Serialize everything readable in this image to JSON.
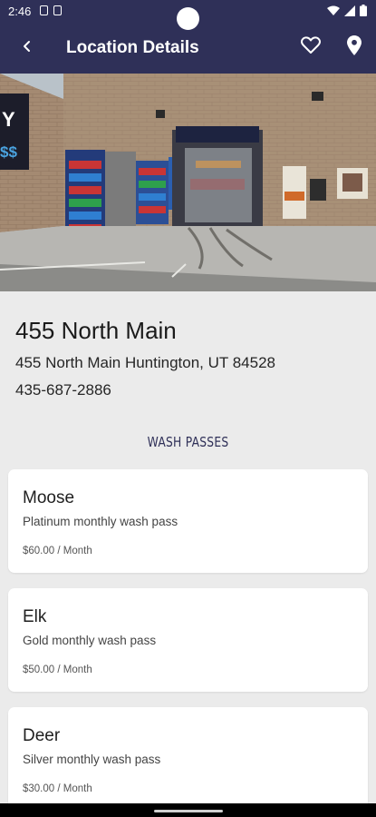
{
  "status_bar": {
    "time": "2:46"
  },
  "app_bar": {
    "title": "Location Details"
  },
  "location": {
    "name": "455 North Main",
    "address": "455 North Main Huntington, UT 84528",
    "phone": "435-687-2886"
  },
  "section_title": "WASH PASSES",
  "passes": [
    {
      "name": "Moose",
      "description": "Platinum monthly wash pass",
      "price": "$60.00 / Month"
    },
    {
      "name": "Elk",
      "description": "Gold monthly wash pass",
      "price": "$50.00 / Month"
    },
    {
      "name": "Deer",
      "description": "Silver monthly wash pass",
      "price": "$30.00 / Month"
    }
  ],
  "icons": {
    "back": "back-arrow-icon",
    "favorite": "heart-icon",
    "map": "location-pin-icon"
  },
  "colors": {
    "primary": "#2f3058",
    "background": "#ebebeb",
    "card": "#ffffff"
  }
}
